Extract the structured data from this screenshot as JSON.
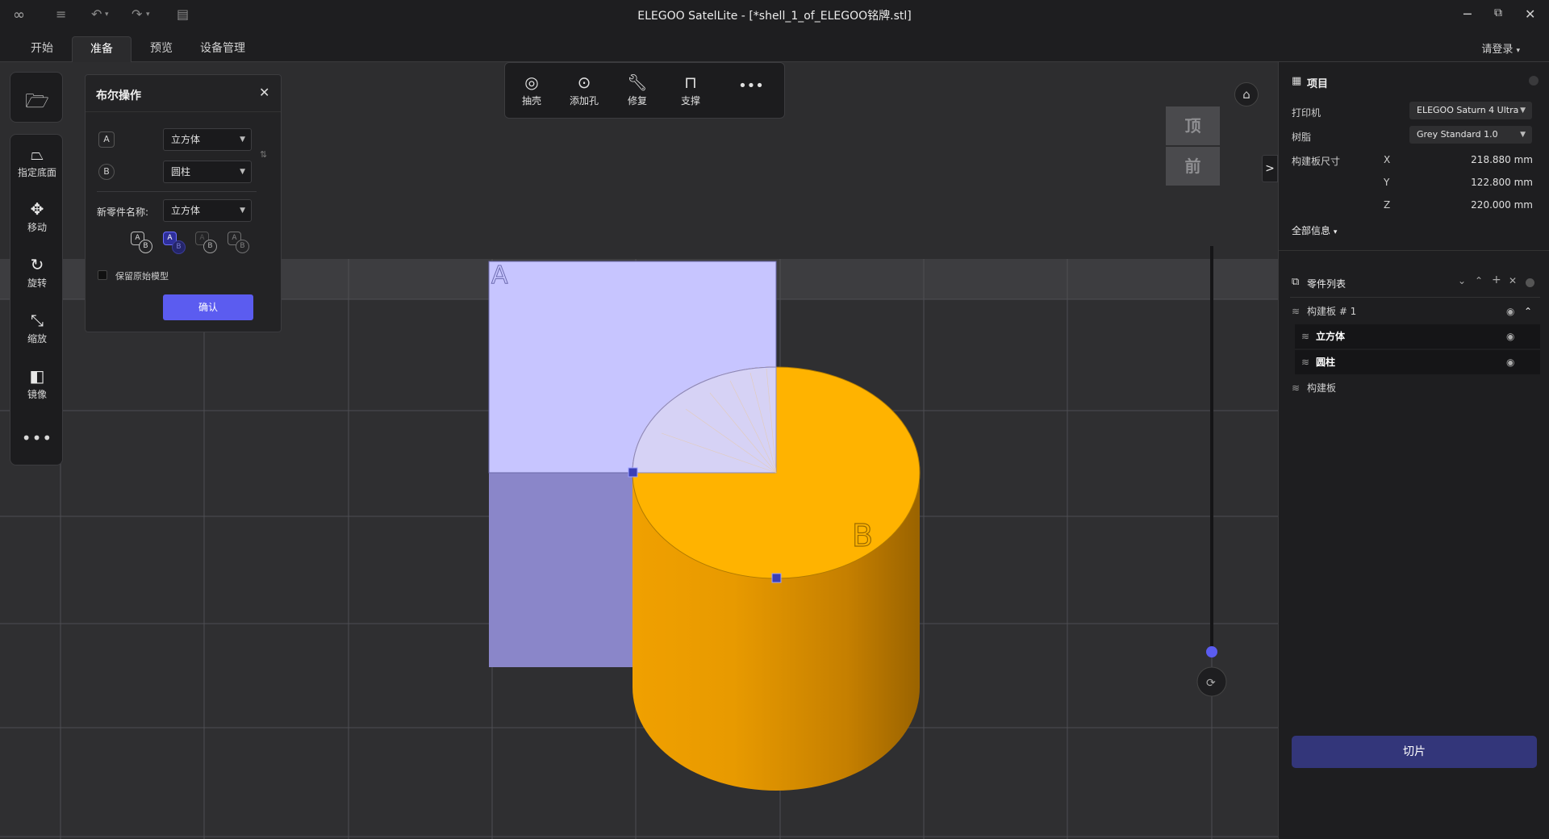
{
  "window": {
    "title": "ELEGOO SatelLite - [*shell_1_of_ELEGOO铭牌.stl]",
    "controls": {
      "minimize": "─",
      "restore": "⧉",
      "close": "✕"
    }
  },
  "tabs": [
    {
      "label": "开始"
    },
    {
      "label": "准备",
      "active": true
    },
    {
      "label": "预览"
    },
    {
      "label": "设备管理"
    }
  ],
  "login": "请登录",
  "left_toolbar": {
    "items": [
      {
        "label": "指定底面",
        "icon": "lay-flat-icon"
      },
      {
        "label": "移动",
        "icon": "move-icon"
      },
      {
        "label": "旋转",
        "icon": "rotate-icon"
      },
      {
        "label": "缩放",
        "icon": "scale-icon"
      },
      {
        "label": "镜像",
        "icon": "mirror-icon"
      }
    ]
  },
  "boolean_panel": {
    "title": "布尔操作",
    "a_label": "A",
    "b_label": "B",
    "a_value": "立方体",
    "b_value": "圆柱",
    "new_name_label": "新零件名称:",
    "new_name_value": "立方体",
    "op_a": "A",
    "op_b": "B",
    "keep_original": "保留原始模型",
    "keep_original_checked": false,
    "confirm": "确认"
  },
  "top_toolbar": [
    {
      "label": "抽壳",
      "icon": "shell-icon"
    },
    {
      "label": "添加孔",
      "icon": "add-hole-icon"
    },
    {
      "label": "修复",
      "icon": "repair-icon"
    },
    {
      "label": "支撑",
      "icon": "support-icon"
    }
  ],
  "view_cube": {
    "top": "顶",
    "front": "前"
  },
  "scene": {
    "label_a": "A",
    "label_b": "B",
    "accent": "#ffb300",
    "cube_color": "#c7c5ff"
  },
  "right_panel": {
    "project_title": "项目",
    "printer_label": "打印机",
    "printer_value": "ELEGOO Saturn 4 Ultra",
    "resin_label": "树脂",
    "resin_value": "Grey Standard 1.0",
    "build_size_label": "构建板尺寸",
    "x_label": "X",
    "x_value": "218.880 mm",
    "y_label": "Y",
    "y_value": "122.800 mm",
    "z_label": "Z",
    "z_value": "220.000 mm",
    "all_info": "全部信息",
    "parts_title": "零件列表",
    "parts": [
      {
        "name": "构建板 # 1"
      },
      {
        "name": "立方体"
      },
      {
        "name": "圆柱"
      },
      {
        "name": "构建板"
      }
    ],
    "slice_button": "切片"
  }
}
